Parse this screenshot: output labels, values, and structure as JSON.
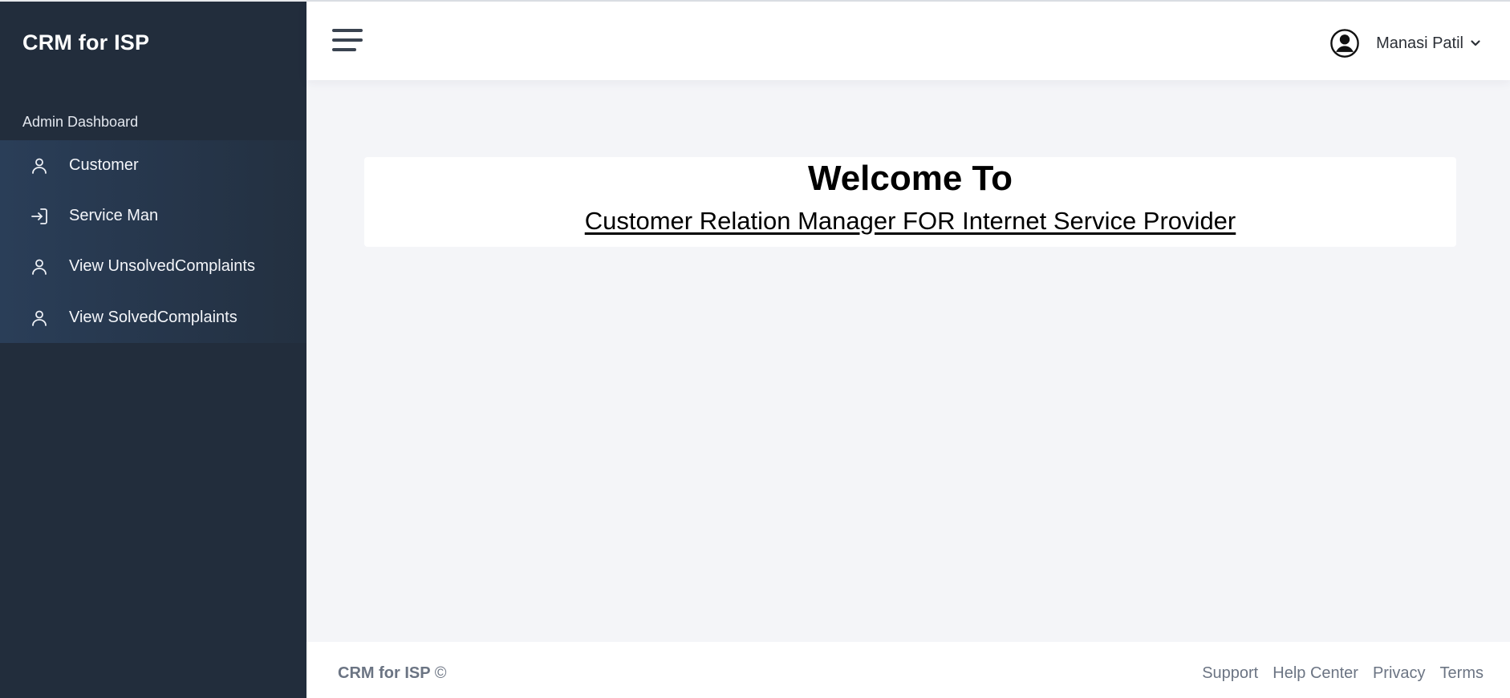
{
  "sidebar": {
    "brand": "CRM for ISP",
    "section_label": "Admin Dashboard",
    "items": [
      {
        "label": "Customer",
        "icon": "user-icon"
      },
      {
        "label": "Service Man",
        "icon": "sign-in-icon"
      },
      {
        "label": "View UnsolvedComplaints",
        "icon": "user-icon"
      },
      {
        "label": "View SolvedComplaints",
        "icon": "user-icon"
      }
    ]
  },
  "header": {
    "menu_icon": "hamburger-icon",
    "user": {
      "name": "Manasi Patil",
      "avatar_icon": "user-circle-icon",
      "dropdown_icon": "chevron-down-icon"
    }
  },
  "main": {
    "welcome_title": "Welcome To",
    "welcome_subtitle": "Customer Relation Manager FOR Internet Service Provider"
  },
  "footer": {
    "brand": "CRM for ISP",
    "copyright_symbol": "©",
    "links": [
      "Support",
      "Help Center",
      "Privacy",
      "Terms"
    ]
  },
  "colors": {
    "sidebar_bg": "#222d3c",
    "nav_bg": "#2a3e58",
    "page_bg": "#f4f5f8",
    "header_bg": "#ffffff",
    "muted_text": "#6b7483"
  }
}
